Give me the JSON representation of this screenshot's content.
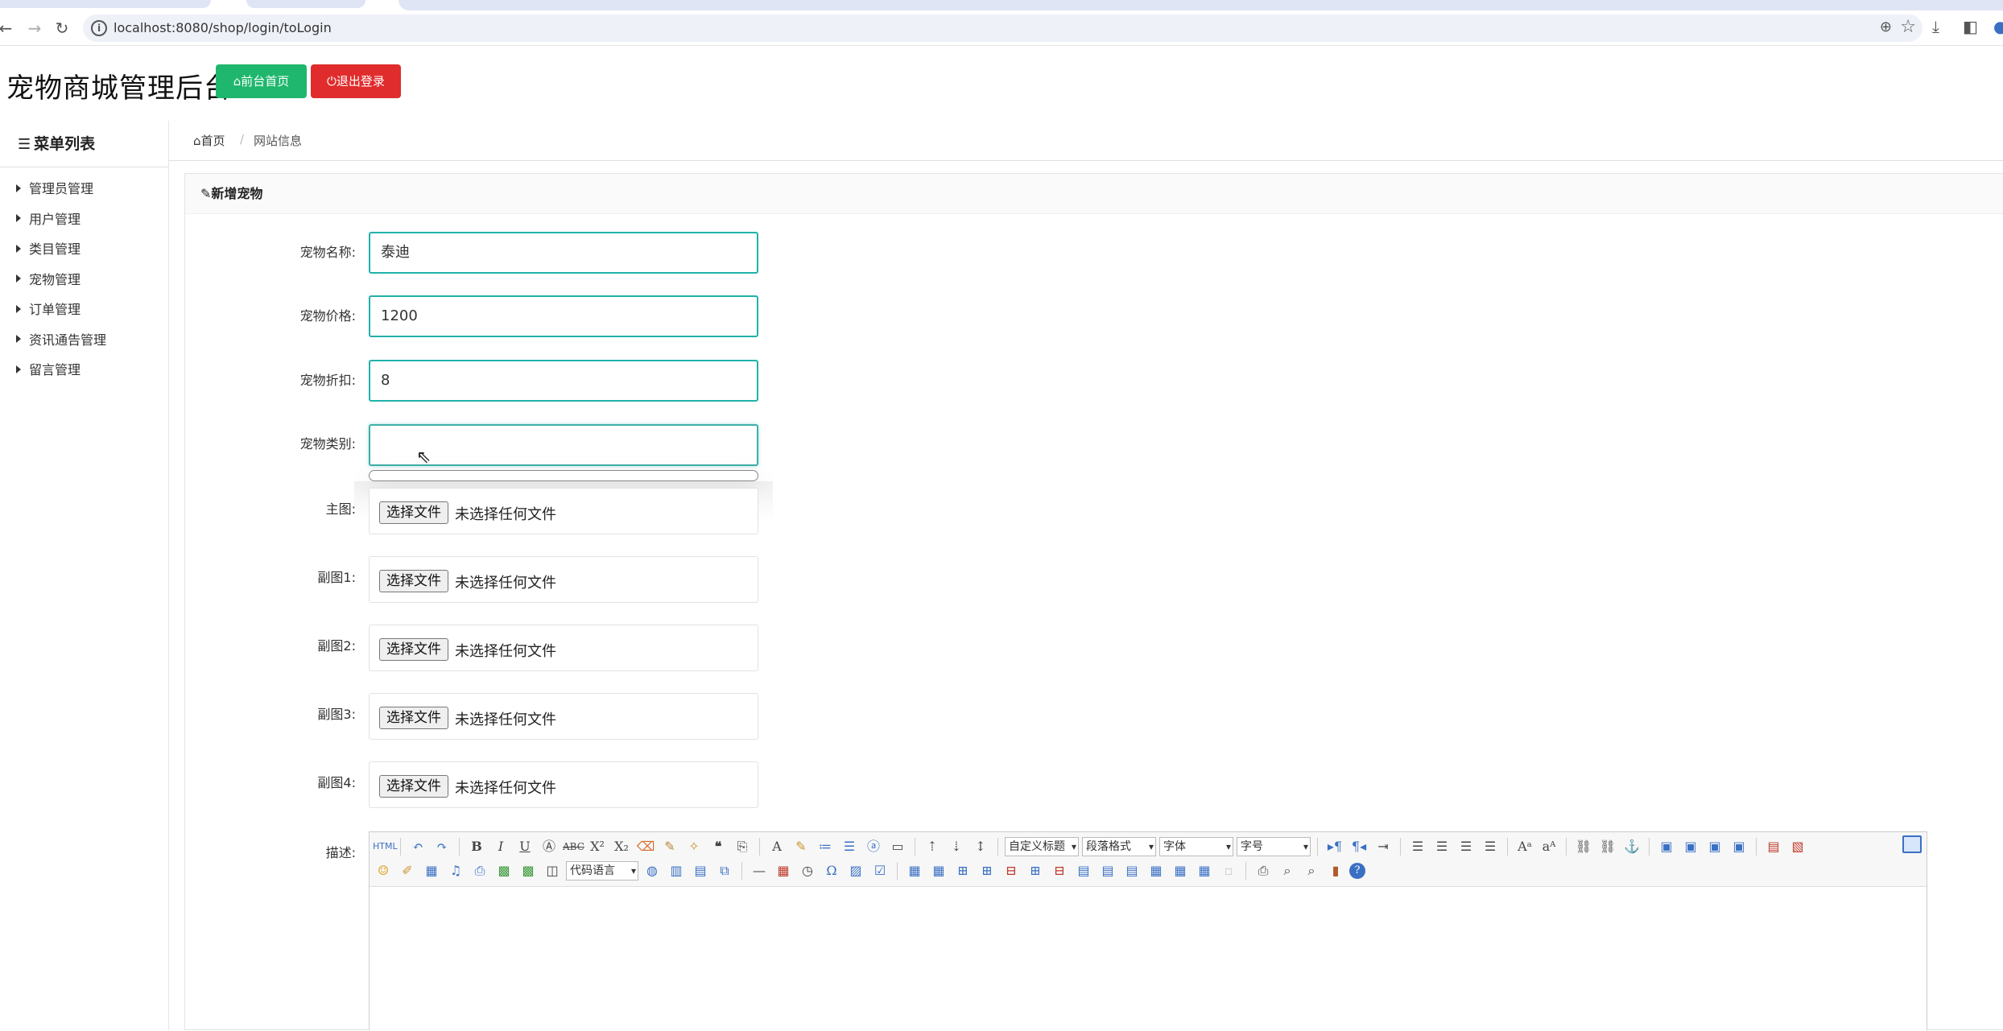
{
  "browser": {
    "url": "localhost:8080/shop/login/toLogin"
  },
  "header": {
    "title": "宠物商城管理后台",
    "front_button": "前台首页",
    "logout_button": "退出登录"
  },
  "sidebar": {
    "heading": "菜单列表",
    "items": [
      {
        "label": "管理员管理"
      },
      {
        "label": "用户管理"
      },
      {
        "label": "类目管理"
      },
      {
        "label": "宠物管理"
      },
      {
        "label": "订单管理"
      },
      {
        "label": "资讯通告管理"
      },
      {
        "label": "留言管理"
      }
    ]
  },
  "breadcrumb": {
    "home": "首页",
    "separator": "/",
    "current": "网站信息"
  },
  "panel": {
    "title": "新增宠物"
  },
  "form": {
    "name_label": "宠物名称:",
    "name_value": "泰迪",
    "price_label": "宠物价格:",
    "price_value": "1200",
    "discount_label": "宠物折扣:",
    "discount_value": "8",
    "category_label": "宠物类别:",
    "category_value": "",
    "main_image_label": "主图:",
    "sub1_label": "副图1:",
    "sub2_label": "副图2:",
    "sub3_label": "副图3:",
    "sub4_label": "副图4:",
    "file_button": "选择文件",
    "file_status": "未选择任何文件",
    "desc_label": "描述:"
  },
  "editor": {
    "heading_select": "自定义标题",
    "paragraph_select": "段落格式",
    "font_select": "字体",
    "size_select": "字号",
    "code_select": "代码语言"
  },
  "colors": {
    "accent_green": "#1fb76d",
    "danger_red": "#e02c2c",
    "input_border": "#20b2aa"
  }
}
